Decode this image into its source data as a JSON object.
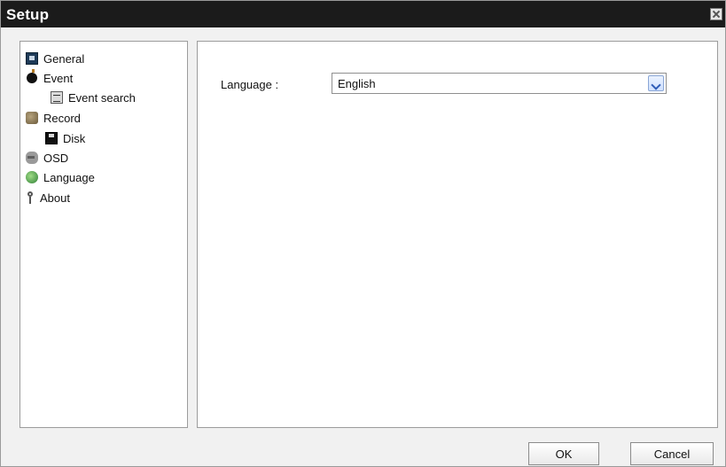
{
  "window": {
    "title": "Setup"
  },
  "tree": {
    "items": [
      {
        "label": "General",
        "icon": "general-icon"
      },
      {
        "label": "Event",
        "icon": "event-icon"
      },
      {
        "label": "Event search",
        "icon": "event-search-icon"
      },
      {
        "label": "Record",
        "icon": "record-icon"
      },
      {
        "label": "Disk",
        "icon": "disk-icon"
      },
      {
        "label": "OSD",
        "icon": "osd-icon"
      },
      {
        "label": "Language",
        "icon": "language-icon"
      },
      {
        "label": "About",
        "icon": "about-icon"
      }
    ]
  },
  "language_panel": {
    "label": "Language :",
    "selected": "English"
  },
  "buttons": {
    "ok": "OK",
    "cancel": "Cancel"
  }
}
